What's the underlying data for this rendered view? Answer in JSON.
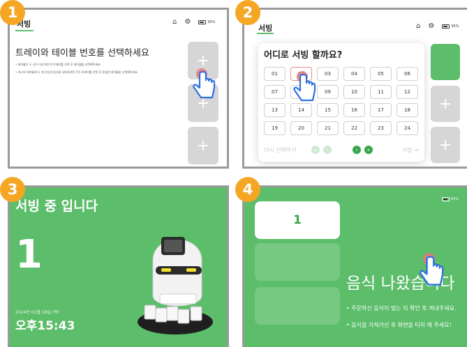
{
  "steps": [
    "1",
    "2",
    "3",
    "4"
  ],
  "panel1": {
    "header_title": "서빙",
    "heading": "트레이와 테이블 번호를 선택하세요",
    "bullets": [
      "• 테이블이 두 곳이 이상이면 빈 트레이를 선택 후 테이블을 선택해주세요.",
      "• 하나의 테이블에 두 개 이상의 음식을 서빙하려면 각각 트레이를 선택 후 동일한 테이블을 선택해주세요."
    ],
    "tiles": [
      "+",
      "+",
      "+"
    ],
    "battery": "95%"
  },
  "panel2": {
    "header_title": "서빙",
    "modal_title": "어디로 서빙 할까요?",
    "tables": [
      "01",
      "02",
      "03",
      "04",
      "05",
      "06",
      "07",
      "08",
      "09",
      "10",
      "11",
      "12",
      "13",
      "14",
      "15",
      "16",
      "17",
      "18",
      "19",
      "20",
      "21",
      "22",
      "23",
      "24"
    ],
    "selected_table": "02",
    "reset_label": "다시 선택하기",
    "next_label": "서빙 →",
    "pager": {
      "first": "«",
      "prev": "‹",
      "next": "›",
      "last": "»"
    },
    "tiles": [
      "",
      "+",
      "+"
    ],
    "battery": "95%"
  },
  "panel3": {
    "title": "서빙 중 입니다",
    "table_number": "1",
    "date": "2024년 01월 18일 (목)",
    "time": "오후15:43"
  },
  "panel4": {
    "card_number": "1",
    "message": "음식 나왔습니다",
    "instructions": [
      "• 주문하신 음식이 맞는 지 확인 후 꺼내주세요.",
      "• 음식을 가져가신 후 화면을 터치 해 주세요!"
    ],
    "battery": "45%"
  },
  "colors": {
    "accent_green": "#5cbd6a",
    "badge_orange": "#f5a623",
    "tile_gray": "#d6d6d6"
  },
  "icons": [
    "home-icon",
    "gear-icon",
    "battery-icon",
    "pointing-hand-icon",
    "robot-server-icon"
  ]
}
